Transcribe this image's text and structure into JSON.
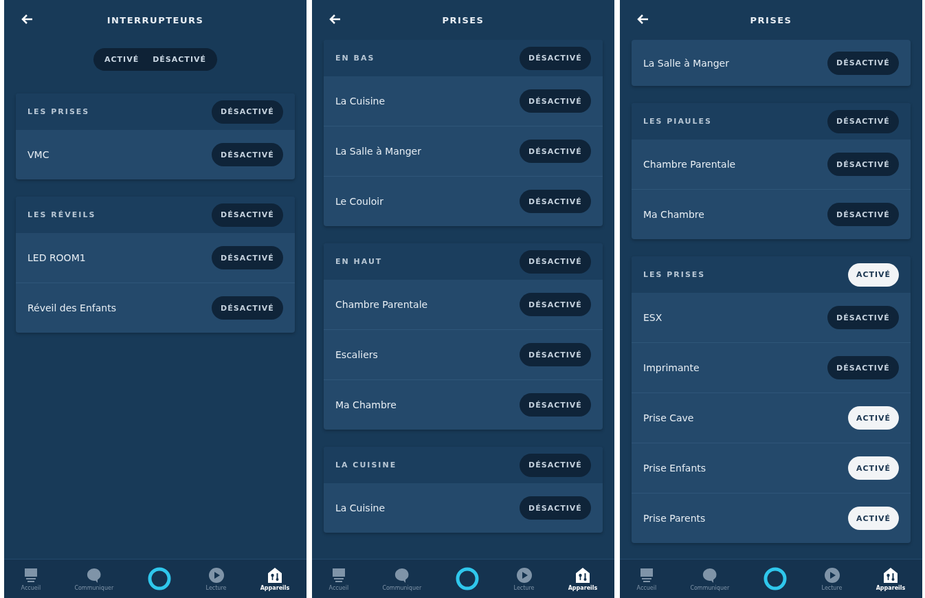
{
  "screens": [
    {
      "title": "INTERRUPTEURS",
      "filter": [
        {
          "label": "ACTIVÉ",
          "selected": false
        },
        {
          "label": "DÉSACTIVÉ",
          "selected": false
        }
      ],
      "groups": [
        {
          "name": "LES PRISES",
          "toggle": {
            "label": "DÉSACTIVÉ",
            "on": false
          },
          "items": [
            {
              "name": "VMC",
              "toggle": {
                "label": "DÉSACTIVÉ",
                "on": false
              }
            }
          ]
        },
        {
          "name": "LES RÉVEILS",
          "toggle": {
            "label": "DÉSACTIVÉ",
            "on": false
          },
          "items": [
            {
              "name": "LED ROOM1",
              "toggle": {
                "label": "DÉSACTIVÉ",
                "on": false
              }
            },
            {
              "name": "Réveil des Enfants",
              "toggle": {
                "label": "DÉSACTIVÉ",
                "on": false
              }
            }
          ]
        }
      ],
      "nav": [
        {
          "label": "Accueil",
          "selected": false
        },
        {
          "label": "Communiquer",
          "selected": false
        },
        {
          "label": "Lecture",
          "selected": false
        },
        {
          "label": "Appareils",
          "selected": true
        }
      ]
    },
    {
      "title": "PRISES",
      "groups": [
        {
          "name": "EN BAS",
          "toggle": {
            "label": "DÉSACTIVÉ",
            "on": false
          },
          "items": [
            {
              "name": "La Cuisine",
              "toggle": {
                "label": "DÉSACTIVÉ",
                "on": false
              }
            },
            {
              "name": "La Salle à Manger",
              "toggle": {
                "label": "DÉSACTIVÉ",
                "on": false
              }
            },
            {
              "name": "Le Couloir",
              "toggle": {
                "label": "DÉSACTIVÉ",
                "on": false
              }
            }
          ]
        },
        {
          "name": "EN HAUT",
          "toggle": {
            "label": "DÉSACTIVÉ",
            "on": false
          },
          "items": [
            {
              "name": "Chambre Parentale",
              "toggle": {
                "label": "DÉSACTIVÉ",
                "on": false
              }
            },
            {
              "name": "Escaliers",
              "toggle": {
                "label": "DÉSACTIVÉ",
                "on": false
              }
            },
            {
              "name": "Ma Chambre",
              "toggle": {
                "label": "DÉSACTIVÉ",
                "on": false
              }
            }
          ]
        },
        {
          "name": "LA CUISINE",
          "toggle": {
            "label": "DÉSACTIVÉ",
            "on": false
          },
          "items": [
            {
              "name": "La Cuisine",
              "toggle": {
                "label": "DÉSACTIVÉ",
                "on": false
              }
            }
          ]
        }
      ],
      "nav": [
        {
          "label": "Accueil",
          "selected": false
        },
        {
          "label": "Communiquer",
          "selected": false
        },
        {
          "label": "Lecture",
          "selected": false
        },
        {
          "label": "Appareils",
          "selected": true
        }
      ]
    },
    {
      "title": "PRISES",
      "groups": [
        {
          "items": [
            {
              "name": "La Salle à Manger",
              "toggle": {
                "label": "DÉSACTIVÉ",
                "on": false
              }
            }
          ]
        },
        {
          "name": "LES PIAULES",
          "toggle": {
            "label": "DÉSACTIVÉ",
            "on": false
          },
          "items": [
            {
              "name": "Chambre Parentale",
              "toggle": {
                "label": "DÉSACTIVÉ",
                "on": false
              }
            },
            {
              "name": "Ma Chambre",
              "toggle": {
                "label": "DÉSACTIVÉ",
                "on": false
              }
            }
          ]
        },
        {
          "name": "LES PRISES",
          "toggle": {
            "label": "ACTIVÉ",
            "on": true
          },
          "items": [
            {
              "name": "ESX",
              "toggle": {
                "label": "DÉSACTIVÉ",
                "on": false
              }
            },
            {
              "name": "Imprimante",
              "toggle": {
                "label": "DÉSACTIVÉ",
                "on": false
              }
            },
            {
              "name": "Prise Cave",
              "toggle": {
                "label": "ACTIVÉ",
                "on": true
              }
            },
            {
              "name": "Prise Enfants",
              "toggle": {
                "label": "ACTIVÉ",
                "on": true
              }
            },
            {
              "name": "Prise Parents",
              "toggle": {
                "label": "ACTIVÉ",
                "on": true
              }
            }
          ]
        }
      ],
      "nav": [
        {
          "label": "Accueil",
          "selected": false
        },
        {
          "label": "Communiquer",
          "selected": false
        },
        {
          "label": "Lecture",
          "selected": false
        },
        {
          "label": "Appareils",
          "selected": true
        }
      ]
    }
  ]
}
